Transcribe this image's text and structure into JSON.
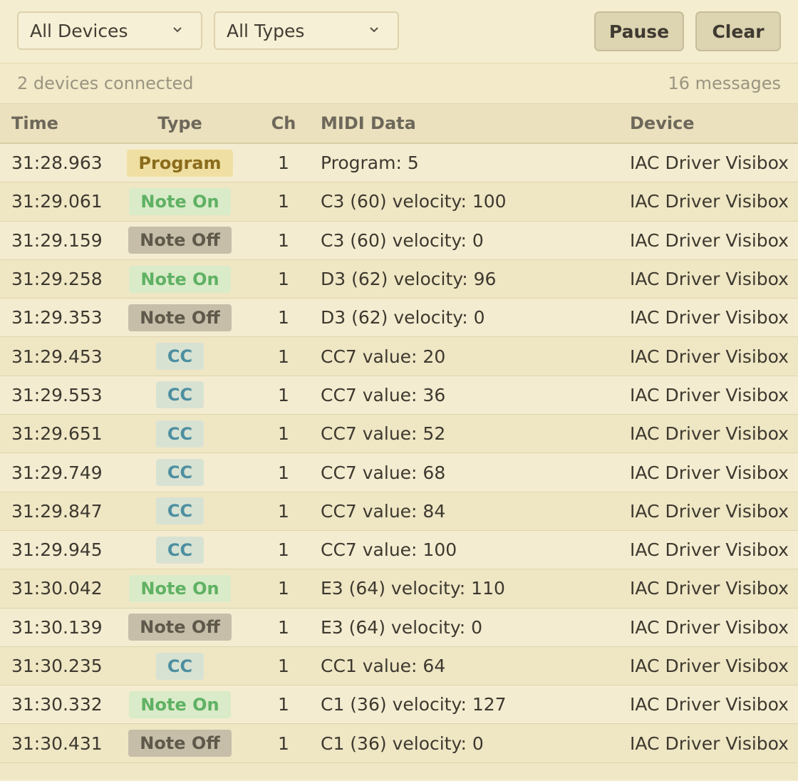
{
  "filters": {
    "devices": "All Devices",
    "types": "All Types"
  },
  "buttons": {
    "pause": "Pause",
    "clear": "Clear"
  },
  "status": {
    "devices_connected": "2 devices connected",
    "message_count": "16 messages"
  },
  "table": {
    "headers": {
      "time": "Time",
      "type": "Type",
      "ch": "Ch",
      "data": "MIDI Data",
      "device": "Device"
    },
    "rows": [
      {
        "time": "31:28.963",
        "type": "Program",
        "kind": "program",
        "ch": "1",
        "data": "Program: 5",
        "device": "IAC Driver Visibox"
      },
      {
        "time": "31:29.061",
        "type": "Note On",
        "kind": "noteon",
        "ch": "1",
        "data": "C3 (60) velocity: 100",
        "device": "IAC Driver Visibox"
      },
      {
        "time": "31:29.159",
        "type": "Note Off",
        "kind": "noteoff",
        "ch": "1",
        "data": "C3 (60) velocity: 0",
        "device": "IAC Driver Visibox"
      },
      {
        "time": "31:29.258",
        "type": "Note On",
        "kind": "noteon",
        "ch": "1",
        "data": "D3 (62) velocity: 96",
        "device": "IAC Driver Visibox"
      },
      {
        "time": "31:29.353",
        "type": "Note Off",
        "kind": "noteoff",
        "ch": "1",
        "data": "D3 (62) velocity: 0",
        "device": "IAC Driver Visibox"
      },
      {
        "time": "31:29.453",
        "type": "CC",
        "kind": "cc",
        "ch": "1",
        "data": "CC7 value: 20",
        "device": "IAC Driver Visibox"
      },
      {
        "time": "31:29.553",
        "type": "CC",
        "kind": "cc",
        "ch": "1",
        "data": "CC7 value: 36",
        "device": "IAC Driver Visibox"
      },
      {
        "time": "31:29.651",
        "type": "CC",
        "kind": "cc",
        "ch": "1",
        "data": "CC7 value: 52",
        "device": "IAC Driver Visibox"
      },
      {
        "time": "31:29.749",
        "type": "CC",
        "kind": "cc",
        "ch": "1",
        "data": "CC7 value: 68",
        "device": "IAC Driver Visibox"
      },
      {
        "time": "31:29.847",
        "type": "CC",
        "kind": "cc",
        "ch": "1",
        "data": "CC7 value: 84",
        "device": "IAC Driver Visibox"
      },
      {
        "time": "31:29.945",
        "type": "CC",
        "kind": "cc",
        "ch": "1",
        "data": "CC7 value: 100",
        "device": "IAC Driver Visibox"
      },
      {
        "time": "31:30.042",
        "type": "Note On",
        "kind": "noteon",
        "ch": "1",
        "data": "E3 (64) velocity: 110",
        "device": "IAC Driver Visibox"
      },
      {
        "time": "31:30.139",
        "type": "Note Off",
        "kind": "noteoff",
        "ch": "1",
        "data": "E3 (64) velocity: 0",
        "device": "IAC Driver Visibox"
      },
      {
        "time": "31:30.235",
        "type": "CC",
        "kind": "cc",
        "ch": "1",
        "data": "CC1 value: 64",
        "device": "IAC Driver Visibox"
      },
      {
        "time": "31:30.332",
        "type": "Note On",
        "kind": "noteon",
        "ch": "1",
        "data": "C1 (36) velocity: 127",
        "device": "IAC Driver Visibox"
      },
      {
        "time": "31:30.431",
        "type": "Note Off",
        "kind": "noteoff",
        "ch": "1",
        "data": "C1 (36) velocity: 0",
        "device": "IAC Driver Visibox"
      }
    ]
  },
  "icons": {
    "dropdown": "chevron-down-icon"
  }
}
